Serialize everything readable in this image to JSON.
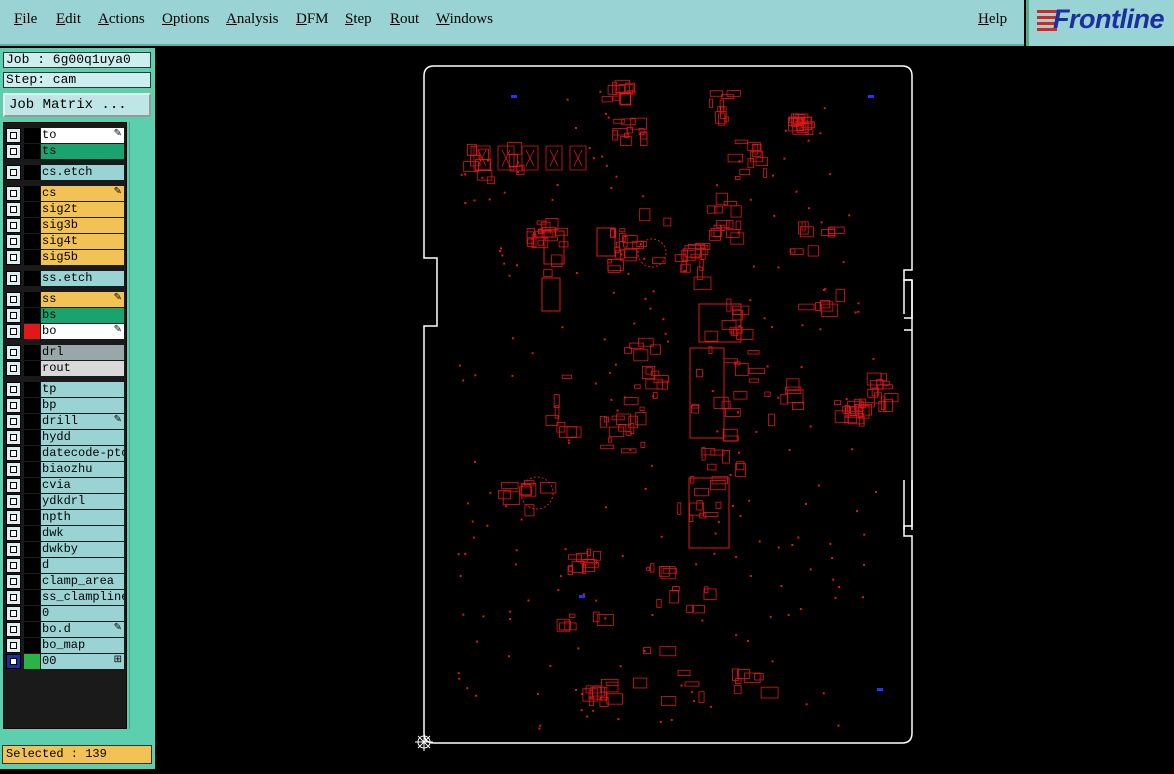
{
  "menu": {
    "items": [
      "File",
      "Edit",
      "Actions",
      "Options",
      "Analysis",
      "DFM",
      "Step",
      "Rout",
      "Windows"
    ],
    "help": "Help"
  },
  "logo": {
    "text": "Frontline"
  },
  "job": {
    "label": "Job : 6g00q1uya0",
    "step": "Step: cam"
  },
  "job_matrix_button": "Job Matrix ...",
  "layers": [
    {
      "name": "to",
      "color": "#ffffff",
      "editable": true
    },
    {
      "name": "ts",
      "color": "#1aa36f",
      "editable": false
    },
    {
      "name": "cs.etch",
      "color": "#9ad3d3",
      "editable": false
    },
    {
      "name": "cs",
      "color": "#f3c255",
      "editable": true
    },
    {
      "name": "sig2t",
      "color": "#f3c255",
      "editable": false
    },
    {
      "name": "sig3b",
      "color": "#f3c255",
      "editable": false
    },
    {
      "name": "sig4t",
      "color": "#f3c255",
      "editable": false
    },
    {
      "name": "sig5b",
      "color": "#f3c255",
      "editable": false
    },
    {
      "name": "ss.etch",
      "color": "#9ad3d3",
      "editable": false
    },
    {
      "name": "ss",
      "color": "#f3c255",
      "editable": true
    },
    {
      "name": "bs",
      "color": "#1aa36f",
      "editable": false
    },
    {
      "name": "bo",
      "color": "#ffffff",
      "editable": true,
      "active": true
    },
    {
      "name": "drl",
      "color": "#98a8a8",
      "editable": false
    },
    {
      "name": "rout",
      "color": "#d9d9d9",
      "editable": false
    },
    {
      "name": "tp",
      "color": "#9ad3d3",
      "editable": false
    },
    {
      "name": "bp",
      "color": "#9ad3d3",
      "editable": false
    },
    {
      "name": "drill",
      "color": "#9ad3d3",
      "editable": true
    },
    {
      "name": "hydd",
      "color": "#9ad3d3",
      "editable": false
    },
    {
      "name": "datecode-ptc",
      "color": "#9ad3d3",
      "editable": false
    },
    {
      "name": "biaozhu",
      "color": "#9ad3d3",
      "editable": false
    },
    {
      "name": "cvia",
      "color": "#9ad3d3",
      "editable": false
    },
    {
      "name": "ydkdrl",
      "color": "#9ad3d3",
      "editable": false
    },
    {
      "name": "npth",
      "color": "#9ad3d3",
      "editable": false
    },
    {
      "name": "dwk",
      "color": "#9ad3d3",
      "editable": false
    },
    {
      "name": "dwkby",
      "color": "#9ad3d3",
      "editable": false
    },
    {
      "name": "d",
      "color": "#9ad3d3",
      "editable": false
    },
    {
      "name": "clamp_area",
      "color": "#9ad3d3",
      "editable": false
    },
    {
      "name": "ss_clampline",
      "color": "#9ad3d3",
      "editable": false
    },
    {
      "name": "0",
      "color": "#9ad3d3",
      "editable": false
    },
    {
      "name": "bo.d",
      "color": "#9ad3d3",
      "editable": true
    },
    {
      "name": "bo_map",
      "color": "#9ad3d3",
      "editable": false
    },
    {
      "name": "00",
      "color": "#9ad3d3",
      "editable": false,
      "special": true
    }
  ],
  "status": {
    "selected": "Selected : 139"
  },
  "colors": {
    "menu_bg": "#9ad3d3",
    "panel_bg": "#5ccfae",
    "feature": "#e01818",
    "outline": "#ffffff",
    "marker": "#2233ff"
  }
}
